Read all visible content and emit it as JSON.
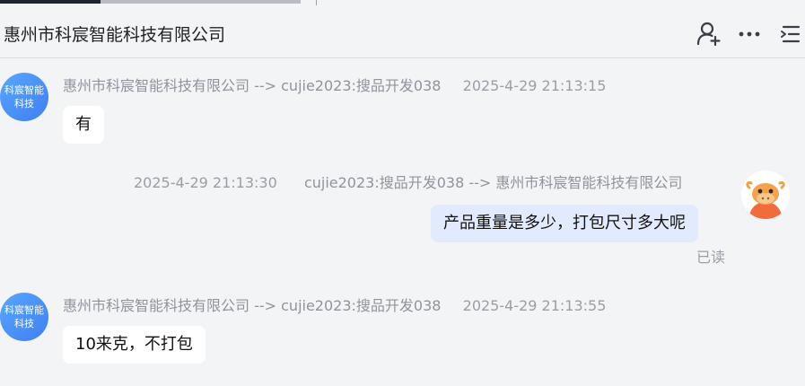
{
  "header": {
    "title": "惠州市科宸智能科技有限公司",
    "icons": [
      "add-contact-icon",
      "more-icon",
      "menu-icon"
    ]
  },
  "messages": [
    {
      "side": "left",
      "avatar_text": "科宸智能科技",
      "avatar_color": "#4a90f5",
      "route": "惠州市科宸智能科技有限公司 --> cujie2023:搜品开发038",
      "time": "2025-4-29 21:13:15",
      "text": "有"
    },
    {
      "side": "right",
      "time": "2025-4-29 21:13:30",
      "route": "cujie2023:搜品开发038 --> 惠州市科宸智能科技有限公司",
      "text": "产品重量是多少，打包尺寸多大呢",
      "status": "已读",
      "bubble_color": "#e1ebfd"
    },
    {
      "side": "left",
      "avatar_text": "科宸智能科技",
      "avatar_color": "#4a90f5",
      "route": "惠州市科宸智能科技有限公司 --> cujie2023:搜品开发038",
      "time": "2025-4-29 21:13:55",
      "text": "10来克，不打包"
    }
  ]
}
